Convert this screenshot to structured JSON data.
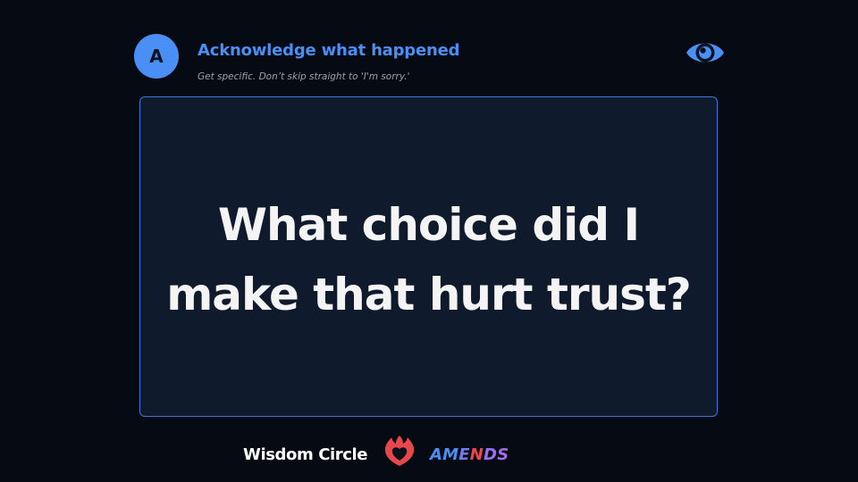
{
  "step": {
    "letter": "A",
    "title": "Acknowledge what happened",
    "subtitle": "Get specific. Don’t skip straight to 'I'm sorry.'",
    "accent_color": "#4a8ff5"
  },
  "toolbar": {
    "reveal_icon": "eye-icon"
  },
  "card": {
    "question": "What choice did I make that hurt trust?",
    "border_color": "#3c79d8",
    "background_color": "#0f1a2d"
  },
  "footer": {
    "brand": "Wisdom Circle",
    "logo_icon": "flame-heart-icon",
    "logo_color": "#e8474c",
    "program_letters": [
      {
        "char": "A",
        "color": "#4a8ff5"
      },
      {
        "char": "M",
        "color": "#4a8ff5"
      },
      {
        "char": "E",
        "color": "#6f7cf0"
      },
      {
        "char": "N",
        "color": "#e8474c"
      },
      {
        "char": "D",
        "color": "#9a6ff0"
      },
      {
        "char": "S",
        "color": "#a66be8"
      }
    ]
  }
}
